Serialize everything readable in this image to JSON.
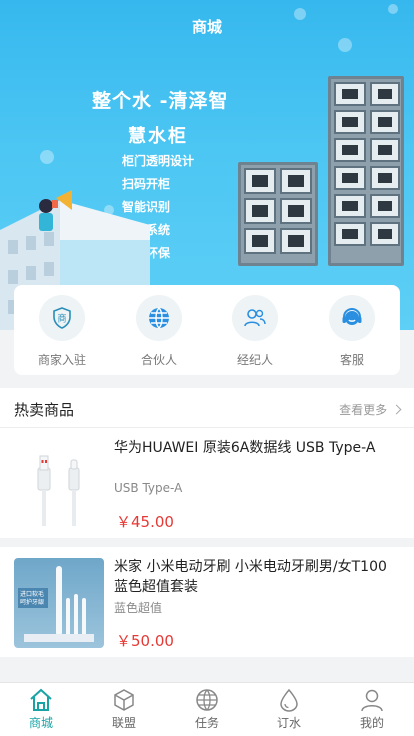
{
  "header": {
    "title": "商城"
  },
  "banner": {
    "line1": "整个水 -清泽智",
    "line2": "慧水柜",
    "features": [
      "柜门透明设计",
      "扫码开柜",
      "智能识别",
      "报警系统",
      "节能环保"
    ]
  },
  "quick_entries": [
    {
      "label": "商家入驻",
      "icon": "shop-shield-icon"
    },
    {
      "label": "合伙人",
      "icon": "globe-icon"
    },
    {
      "label": "经纪人",
      "icon": "people-icon"
    },
    {
      "label": "客服",
      "icon": "headset-icon"
    }
  ],
  "hot": {
    "title": "热卖商品",
    "more_label": "查看更多"
  },
  "products": [
    {
      "name": "华为HUAWEI 原装6A数据线 USB Type-A",
      "subtitle": "USB Type-A",
      "price": "￥45.00"
    },
    {
      "name": "米家 小米电动牙刷 小米电动牙刷男/女T100蓝色超值套装",
      "subtitle": "蓝色超值",
      "price": "￥50.00"
    }
  ],
  "tabs": [
    {
      "label": "商城",
      "icon": "home-icon",
      "active": true
    },
    {
      "label": "联盟",
      "icon": "cube-icon",
      "active": false
    },
    {
      "label": "任务",
      "icon": "globe-icon",
      "active": false
    },
    {
      "label": "订水",
      "icon": "water-drop-icon",
      "active": false
    },
    {
      "label": "我的",
      "icon": "user-icon",
      "active": false
    }
  ],
  "colors": {
    "accent": "#1aa3a5",
    "price": "#e53935",
    "banner": "#4cc6f3"
  }
}
